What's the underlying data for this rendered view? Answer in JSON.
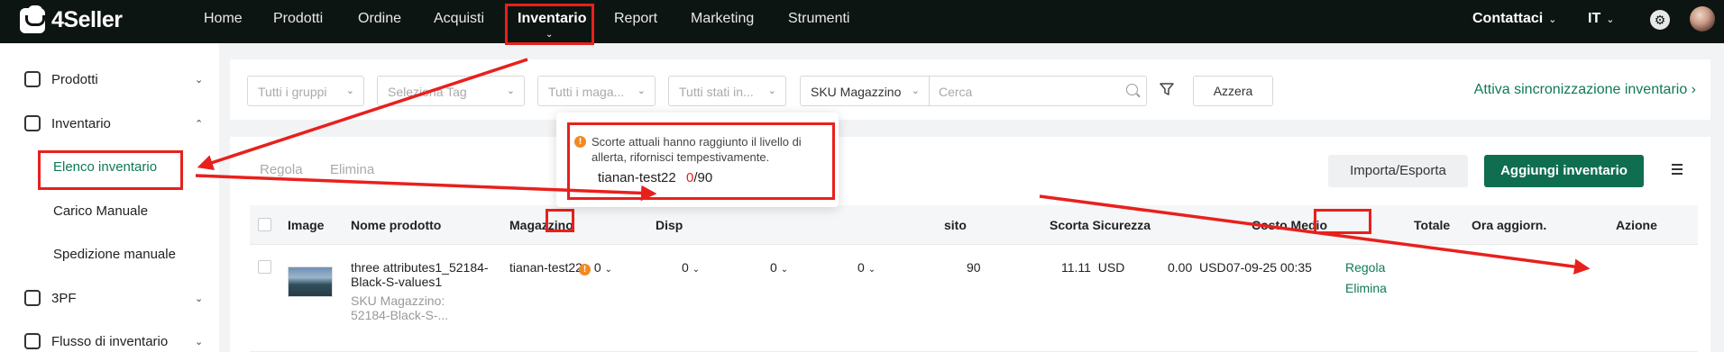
{
  "topbar": {
    "logo_text": "4Seller",
    "nav": [
      "Home",
      "Prodotti",
      "Ordine",
      "Acquisti",
      "Inventario",
      "Report",
      "Marketing",
      "Strumenti"
    ],
    "contact_label": "Contattaci",
    "language_label": "IT"
  },
  "sidebar": {
    "groups": [
      {
        "label": "Prodotti",
        "expanded": false
      },
      {
        "label": "Inventario",
        "expanded": true
      },
      {
        "label": "3PF",
        "expanded": false
      },
      {
        "label": "Flusso di inventario",
        "expanded": false
      }
    ],
    "inventario_items": [
      "Elenco inventario",
      "Carico Manuale",
      "Spedizione manuale"
    ],
    "active_item": "Elenco inventario"
  },
  "filters": {
    "groups_placeholder": "Tutti i gruppi",
    "tag_placeholder": "Seleziona Tag",
    "warehouse_placeholder": "Tutti i maga...",
    "status_placeholder": "Tutti stati in...",
    "search_field_value": "SKU Magazzino",
    "search_placeholder": "Cerca",
    "reset_label": "Azzera",
    "sync_link": "Attiva sincronizzazione inventario"
  },
  "toolbar": {
    "tab_regola": "Regola",
    "tab_elimina": "Elimina",
    "import_export_label": "Importa/Esporta",
    "add_label": "Aggiungi inventario"
  },
  "table": {
    "headers": {
      "image": "Image",
      "product": "Nome prodotto",
      "warehouse": "Magazzino",
      "available": "Disp",
      "transit": "sito",
      "safety": "Scorta Sicurezza",
      "avg_cost": "Costo Medio",
      "total": "Totale",
      "updated": "Ora aggiorn.",
      "action": "Azione"
    },
    "row": {
      "product_name_1": "three attributes1_52184-",
      "product_name_2": "Black-S-values1",
      "sku_label": "SKU Magazzino:",
      "sku_value": "52184-Black-S-...",
      "warehouse": "tianan-test22",
      "available": "0",
      "col2": "0",
      "col3": "0",
      "col4": "0",
      "safety_stock": "90",
      "avg_cost": "11.11",
      "avg_cost_currency": "USD",
      "total": "0.00",
      "total_currency": "USD",
      "updated": "07-09-25 00:35",
      "action_adjust": "Regola",
      "action_delete": "Elimina"
    }
  },
  "tooltip": {
    "message": "Scorte attuali hanno raggiunto il livello di allerta, rifornisci tempestivamente.",
    "warehouse": "tianan-test22",
    "current": "0",
    "separator": "/90"
  },
  "colors": {
    "accent_green": "#0f7a55",
    "primary_button": "#0f6e50",
    "highlight_red": "#e8201c",
    "warning_orange": "#f08a24",
    "topbar": "#0d1512"
  }
}
